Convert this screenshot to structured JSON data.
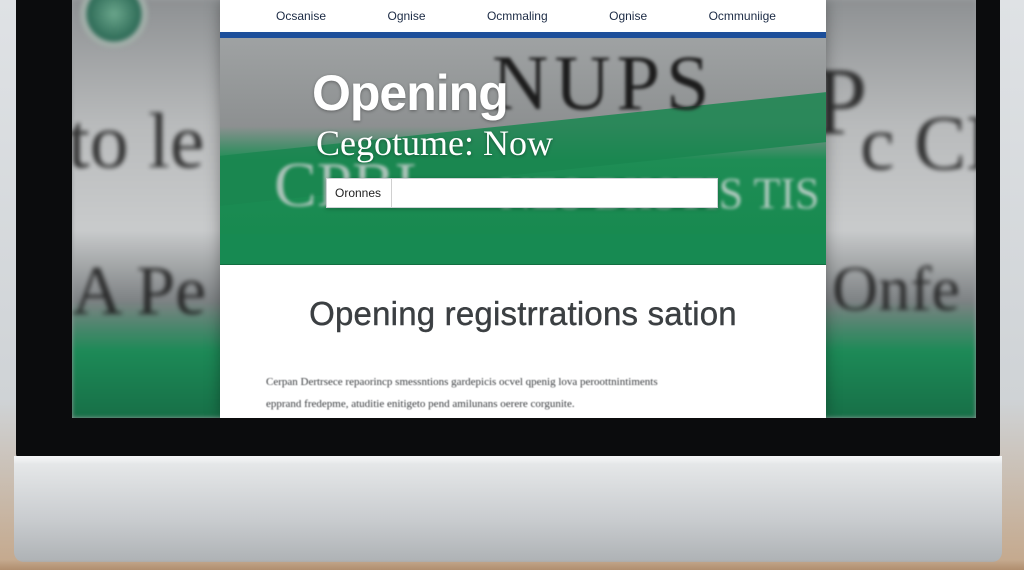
{
  "nav": {
    "items": [
      "Ocsanise",
      "Ognise",
      "Ocmmaling",
      "Ognise",
      "Ocmmuniige"
    ]
  },
  "hero": {
    "title": "Opening",
    "subtitle": "Cegotume: Now"
  },
  "search": {
    "button_label": "Oronnes",
    "value": "",
    "placeholder": ""
  },
  "content": {
    "title": "Opening registrrations sation",
    "body_lines": [
      "Cerpan Dertrsece repaorincp smessntions gardepicis ocvel qpenig lova peroottnintiments",
      "epprand fredepme, atuditie enitigeto pend amilunans oerere corgunite."
    ]
  },
  "backdrop": {
    "left_text_top": "to le",
    "left_text_bottom": "A Pe",
    "right_text_top": "CP",
    "right_text_mid": "c CE",
    "right_text_bottom": "Onfe",
    "sign_top": "NUPS",
    "sign_bottom_left": "CPBL",
    "sign_bottom_right": "NES BIISTIS TIS CL"
  },
  "colors": {
    "accent_blue": "#1d4f9a",
    "brand_green": "#178a52",
    "bezel": "#0b0c0d"
  }
}
